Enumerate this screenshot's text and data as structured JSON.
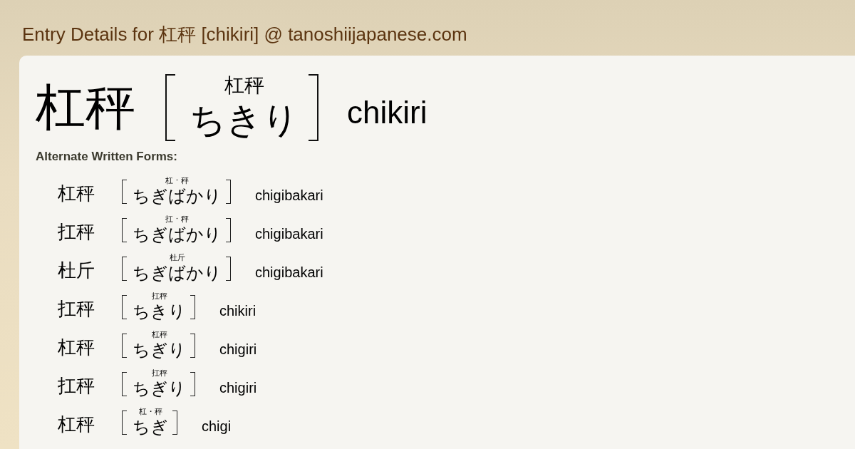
{
  "page_title": "Entry Details for 杠秤 [chikiri] @ tanoshiijapanese.com",
  "entry": {
    "written": "杠秤",
    "ruby": "杠秤",
    "reading": "ちきり",
    "romaji": "chikiri"
  },
  "alternate_forms": {
    "heading": "Alternate Written Forms:",
    "items": [
      {
        "written": "杠秤",
        "ruby": "杠 · 秤",
        "reading": "ちぎばかり",
        "romaji": "chigibakari"
      },
      {
        "written": "扛秤",
        "ruby": "扛 · 秤",
        "reading": "ちぎばかり",
        "romaji": "chigibakari"
      },
      {
        "written": "杜斤",
        "ruby": "杜斤",
        "reading": "ちぎばかり",
        "romaji": "chigibakari"
      },
      {
        "written": "扛秤",
        "ruby": "扛秤",
        "reading": "ちきり",
        "romaji": "chikiri"
      },
      {
        "written": "杠秤",
        "ruby": "杠秤",
        "reading": "ちぎり",
        "romaji": "chigiri"
      },
      {
        "written": "扛秤",
        "ruby": "扛秤",
        "reading": "ちぎり",
        "romaji": "chigiri"
      },
      {
        "written": "杠秤",
        "ruby": "杠・秤",
        "reading": "ちぎ",
        "romaji": "chigi"
      }
    ]
  }
}
